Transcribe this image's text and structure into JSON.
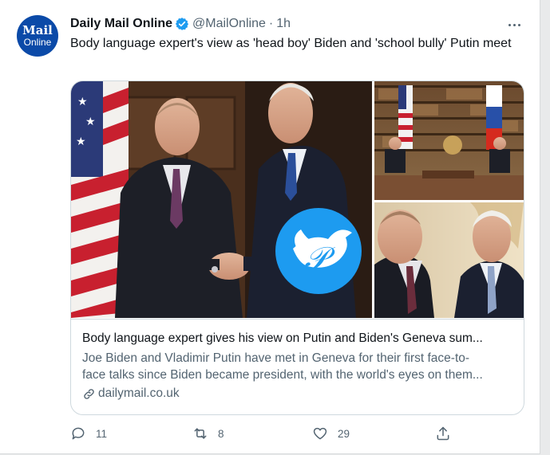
{
  "account": {
    "avatar_line1": "Mail",
    "avatar_line2": "Online",
    "name": "Daily Mail Online",
    "handle": "@MailOnline",
    "separator": "·",
    "time": "1h"
  },
  "tweet": {
    "text": "Body language expert's view as 'head boy' Biden and 'school bully' Putin meet"
  },
  "card": {
    "title": "Body language expert gives his view on Putin and Biden's Geneva sum...",
    "description_line1": "Joe Biden and Vladimir Putin have met in Geneva for their first face-to-",
    "description_line2": "face talks since Biden became president, with the world's eyes on them...",
    "domain": "dailymail.co.uk"
  },
  "actions": {
    "reply_count": "11",
    "retweet_count": "8",
    "like_count": "29"
  },
  "icons": [
    "verified-badge-icon",
    "more-icon",
    "link-icon",
    "reply-icon",
    "retweet-icon",
    "like-icon",
    "share-icon",
    "watermark-bird-icon"
  ],
  "colors": {
    "verified": "#1d9bf0",
    "avatar_bg": "#0b4aa8",
    "secondary_text": "#536471",
    "border": "#cfd9de"
  }
}
